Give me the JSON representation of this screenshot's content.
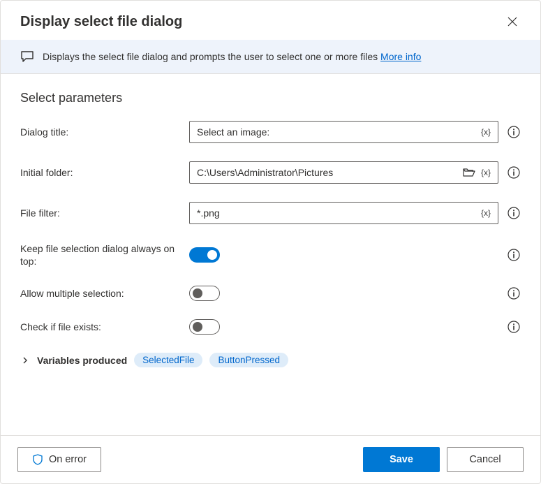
{
  "header": {
    "title": "Display select file dialog"
  },
  "banner": {
    "text": "Displays the select file dialog and prompts the user to select one or more files ",
    "link": "More info"
  },
  "section": {
    "title": "Select parameters"
  },
  "params": {
    "dialog_title": {
      "label": "Dialog title:",
      "value": "Select an image:"
    },
    "initial_folder": {
      "label": "Initial folder:",
      "value": "C:\\Users\\Administrator\\Pictures"
    },
    "file_filter": {
      "label": "File filter:",
      "value": "*.png"
    },
    "always_on_top": {
      "label": "Keep file selection dialog always on top:",
      "on": true
    },
    "allow_multiple": {
      "label": "Allow multiple selection:",
      "on": false
    },
    "check_exists": {
      "label": "Check if file exists:",
      "on": false
    }
  },
  "variables": {
    "label": "Variables produced",
    "items": [
      "SelectedFile",
      "ButtonPressed"
    ]
  },
  "footer": {
    "on_error": "On error",
    "save": "Save",
    "cancel": "Cancel"
  }
}
